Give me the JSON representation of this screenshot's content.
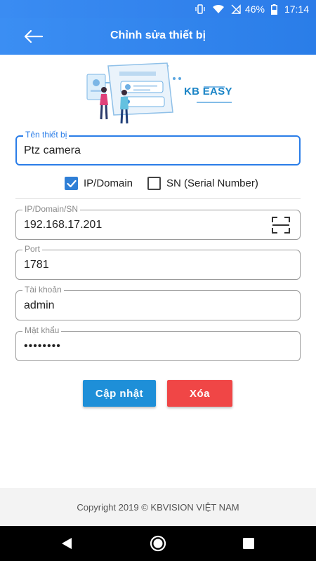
{
  "status_bar": {
    "battery": "46%",
    "time": "17:14",
    "icons": [
      "vibrate-icon",
      "wifi-icon",
      "no-sim-icon",
      "battery-icon"
    ]
  },
  "app_bar": {
    "title": "Chỉnh sửa thiết bị",
    "back_icon": "arrow-left-icon"
  },
  "brand": "KB EASY",
  "form": {
    "device_name": {
      "label": "Tên thiết bị",
      "value": "Ptz camera"
    },
    "mode": {
      "options": [
        {
          "label": "IP/Domain",
          "checked": true
        },
        {
          "label": "SN (Serial Number)",
          "checked": false
        }
      ]
    },
    "ip": {
      "label": "IP/Domain/SN",
      "value": "192.168.17.201",
      "icon": "scan-icon"
    },
    "port": {
      "label": "Port",
      "value": "1781"
    },
    "account": {
      "label": "Tài khoản",
      "value": "admin"
    },
    "password": {
      "label": "Mật khẩu",
      "value": "••••••••"
    }
  },
  "buttons": {
    "update_label": "Cập nhật",
    "delete_label": "Xóa"
  },
  "footer": "Copyright 2019 © KBVISION VIỆT NAM",
  "colors": {
    "primary": "#2a7de8",
    "update": "#1e8fd8",
    "delete": "#f04646"
  }
}
